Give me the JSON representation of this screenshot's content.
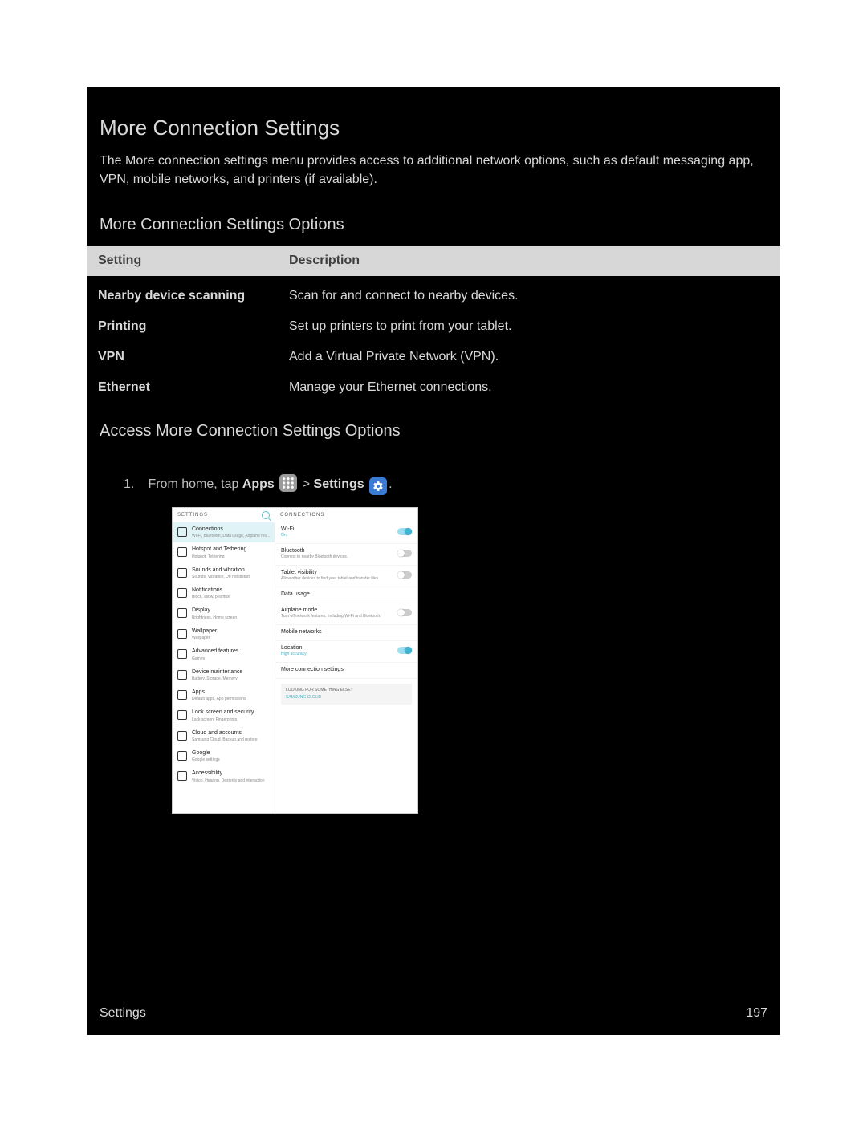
{
  "page": {
    "title": "More Connection Settings",
    "intro": "The More connection settings menu provides access to additional network options, such as default messaging app, VPN, mobile networks, and printers (if available).",
    "optionsHeading": "More Connection Settings Options",
    "accessHeading": "Access More Connection Settings Options",
    "footerLabel": "Settings",
    "pageNumber": "197"
  },
  "table": {
    "headers": {
      "setting": "Setting",
      "description": "Description"
    },
    "rows": [
      {
        "setting": "Nearby device scanning",
        "description": "Scan for and connect to nearby devices."
      },
      {
        "setting": "Printing",
        "description": "Set up printers to print from your tablet."
      },
      {
        "setting": "VPN",
        "description": "Add a Virtual Private Network (VPN)."
      },
      {
        "setting": "Ethernet",
        "description": "Manage your Ethernet connections."
      }
    ]
  },
  "step": {
    "lead": "From home, tap ",
    "apps": "Apps",
    "arrow": " > ",
    "settings": "Settings",
    "period": "."
  },
  "screenshot": {
    "leftHeader": "SETTINGS",
    "rightHeader": "CONNECTIONS",
    "looking": {
      "title": "LOOKING FOR SOMETHING ELSE?",
      "link": "SAMSUNG CLOUD"
    },
    "left": [
      {
        "title": "Connections",
        "sub": "Wi-Fi, Bluetooth, Data usage, Airplane mo...",
        "ic": "ic-teal",
        "active": true
      },
      {
        "title": "Hotspot and Tethering",
        "sub": "Hotspot, Tethering",
        "ic": "ic-pink"
      },
      {
        "title": "Sounds and vibration",
        "sub": "Sounds, Vibration, Do not disturb",
        "ic": "ic-orange"
      },
      {
        "title": "Notifications",
        "sub": "Block, allow, prioritize",
        "ic": "ic-orange2"
      },
      {
        "title": "Display",
        "sub": "Brightness, Home screen",
        "ic": "ic-green"
      },
      {
        "title": "Wallpaper",
        "sub": "Wallpaper",
        "ic": "ic-blue"
      },
      {
        "title": "Advanced features",
        "sub": "Games",
        "ic": "ic-red"
      },
      {
        "title": "Device maintenance",
        "sub": "Battery, Storage, Memory",
        "ic": "ic-cyan"
      },
      {
        "title": "Apps",
        "sub": "Default apps, App permissions",
        "ic": "ic-gray"
      },
      {
        "title": "Lock screen and security",
        "sub": "Lock screen, Fingerprints",
        "ic": "ic-sky"
      },
      {
        "title": "Cloud and accounts",
        "sub": "Samsung Cloud, Backup and restore",
        "ic": "ic-mint"
      },
      {
        "title": "Google",
        "sub": "Google settings",
        "ic": "ic-coral"
      },
      {
        "title": "Accessibility",
        "sub": "Vision, Hearing, Dexterity and interaction",
        "ic": "ic-star"
      }
    ],
    "right": [
      {
        "title": "Wi-Fi",
        "sub": "On",
        "on": true,
        "toggle": "on"
      },
      {
        "title": "Bluetooth",
        "sub": "Connect to nearby Bluetooth devices.",
        "toggle": "off"
      },
      {
        "title": "Tablet visibility",
        "sub": "Allow other devices to find your tablet and transfer files.",
        "toggle": "off"
      },
      {
        "title": "Data usage",
        "sub": ""
      },
      {
        "title": "Airplane mode",
        "sub": "Turn off network features, including Wi-Fi and Bluetooth.",
        "toggle": "off"
      },
      {
        "title": "Mobile networks",
        "sub": ""
      },
      {
        "title": "Location",
        "sub": "High accuracy",
        "on": true,
        "toggle": "on"
      },
      {
        "title": "More connection settings",
        "sub": ""
      }
    ]
  }
}
